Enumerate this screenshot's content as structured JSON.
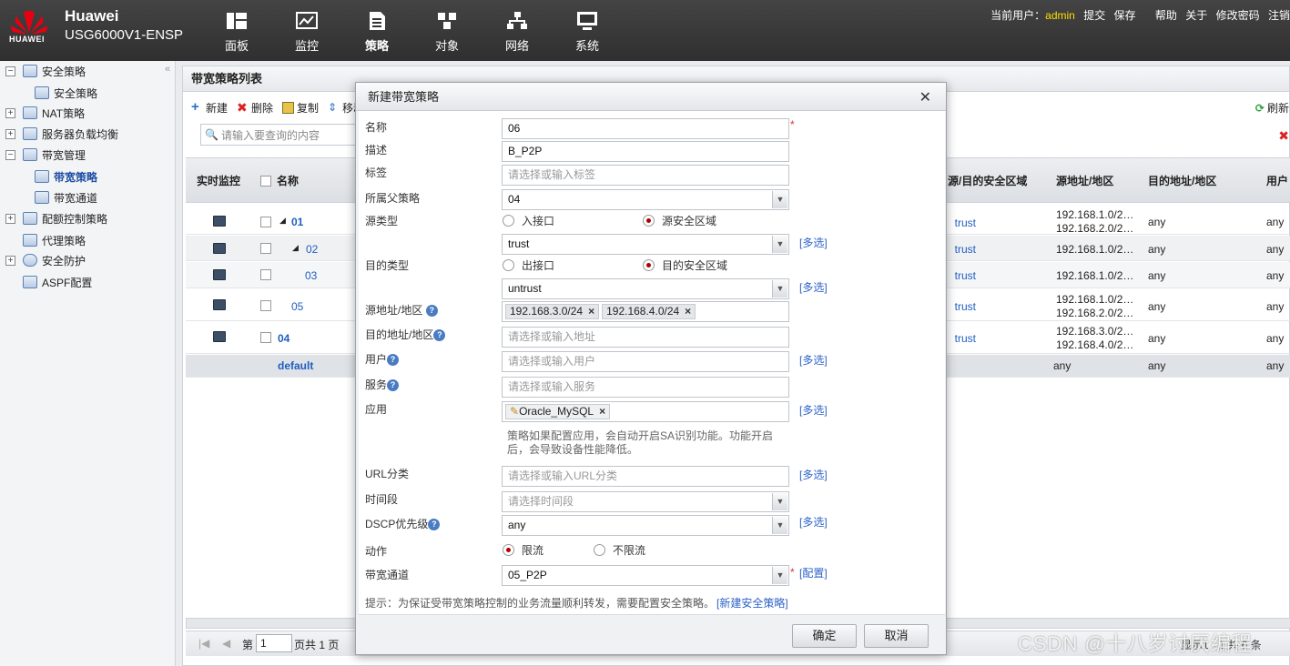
{
  "header": {
    "brand": "Huawei",
    "logo_text": "HUAWEI",
    "model": "USG6000V1-ENSP",
    "nav": [
      {
        "label": "面板",
        "icon": "dashboard-icon"
      },
      {
        "label": "监控",
        "icon": "monitor-icon"
      },
      {
        "label": "策略",
        "icon": "policy-icon"
      },
      {
        "label": "对象",
        "icon": "object-icon"
      },
      {
        "label": "网络",
        "icon": "network-icon"
      },
      {
        "label": "系统",
        "icon": "system-icon"
      }
    ],
    "active_nav": "策略",
    "user_label": "当前用户：",
    "user_name": "admin",
    "links": [
      "提交",
      "保存",
      "帮助",
      "关于",
      "修改密码",
      "注销"
    ]
  },
  "sidebar": {
    "items": [
      {
        "label": "安全策略",
        "expand": "−"
      },
      {
        "label": "安全策略"
      },
      {
        "label": "NAT策略",
        "expand": "+"
      },
      {
        "label": "服务器负载均衡",
        "expand": "+"
      },
      {
        "label": "带宽管理",
        "expand": "−"
      },
      {
        "label": "带宽策略"
      },
      {
        "label": "带宽通道"
      },
      {
        "label": "配额控制策略",
        "expand": "+"
      },
      {
        "label": "代理策略"
      },
      {
        "label": "安全防护",
        "expand": "+"
      },
      {
        "label": "ASPF配置"
      }
    ],
    "collapse": "«"
  },
  "main": {
    "title": "带宽策略列表",
    "toolbar": {
      "new": "新建",
      "delete": "删除",
      "copy": "复制",
      "move": "移动"
    },
    "refresh": "刷新",
    "search_placeholder": "请输入要查询的内容",
    "columns": {
      "monitor": "实时监控",
      "name": "名称",
      "zone": "源/目的安全区域",
      "src": "源地址/地区",
      "dst": "目的地址/地区",
      "user": "用户"
    },
    "rows": [
      {
        "name": "01",
        "zone": "trust",
        "src1": "192.168.1.0/2…",
        "src2": "192.168.2.0/2…",
        "dst": "any",
        "user": "any"
      },
      {
        "name": "02",
        "zone": "trust",
        "src1": "192.168.1.0/2…",
        "src2": "",
        "dst": "any",
        "user": "any"
      },
      {
        "name": "03",
        "zone": "trust",
        "src1": "192.168.1.0/2…",
        "src2": "",
        "dst": "any",
        "user": "any"
      },
      {
        "name": "05",
        "zone": "trust",
        "src1": "192.168.1.0/2…",
        "src2": "192.168.2.0/2…",
        "dst": "any",
        "user": "any"
      },
      {
        "name": "04",
        "zone": "trust",
        "src1": "192.168.3.0/2…",
        "src2": "192.168.4.0/2…",
        "dst": "any",
        "user": "any"
      },
      {
        "name": "default",
        "zone": "",
        "src1": "any",
        "src2": "",
        "dst": "any",
        "user": "any"
      }
    ],
    "pager": {
      "page_label": "第",
      "page": "1",
      "total": "页共 1 页",
      "right": "显示1 - 1 共 6 条"
    }
  },
  "dialog": {
    "title": "新建带宽策略",
    "fields": {
      "name_label": "名称",
      "name_value": "06",
      "desc_label": "描述",
      "desc_value": "B_P2P",
      "tag_label": "标签",
      "tag_placeholder": "请选择或输入标签",
      "parent_label": "所属父策略",
      "parent_value": "04",
      "src_type_label": "源类型",
      "src_opt1": "入接口",
      "src_opt2": "源安全区域",
      "src_zone_value": "trust",
      "dst_type_label": "目的类型",
      "dst_opt1": "出接口",
      "dst_opt2": "目的安全区域",
      "dst_zone_value": "untrust",
      "src_addr_label": "源地址/地区",
      "src_addr_tags": [
        "192.168.3.0/24",
        "192.168.4.0/24"
      ],
      "dst_addr_label": "目的地址/地区",
      "dst_addr_placeholder": "请选择或输入地址",
      "user_label": "用户",
      "user_placeholder": "请选择或输入用户",
      "service_label": "服务",
      "service_placeholder": "请选择或输入服务",
      "app_label": "应用",
      "app_tag": "Oracle_MySQL",
      "app_note": "策略如果配置应用，会自动开启SA识别功能。功能开启后，会导致设备性能降低。",
      "url_label": "URL分类",
      "url_placeholder": "请选择或输入URL分类",
      "time_label": "时间段",
      "time_placeholder": "请选择时间段",
      "dscp_label": "DSCP优先级",
      "dscp_value": "any",
      "action_label": "动作",
      "action_opt1": "限流",
      "action_opt2": "不限流",
      "channel_label": "带宽通道",
      "channel_value": "05_P2P"
    },
    "multi_select": "[多选]",
    "config_link": "[配置]",
    "required_mark": "*",
    "tip_text": "提示：为保证受带宽策略控制的业务流量顺利转发，需要配置安全策略。",
    "tip_link": "[新建安全策略]",
    "ok": "确定",
    "cancel": "取消"
  },
  "watermark": "CSDN @十八岁讨厌编程"
}
